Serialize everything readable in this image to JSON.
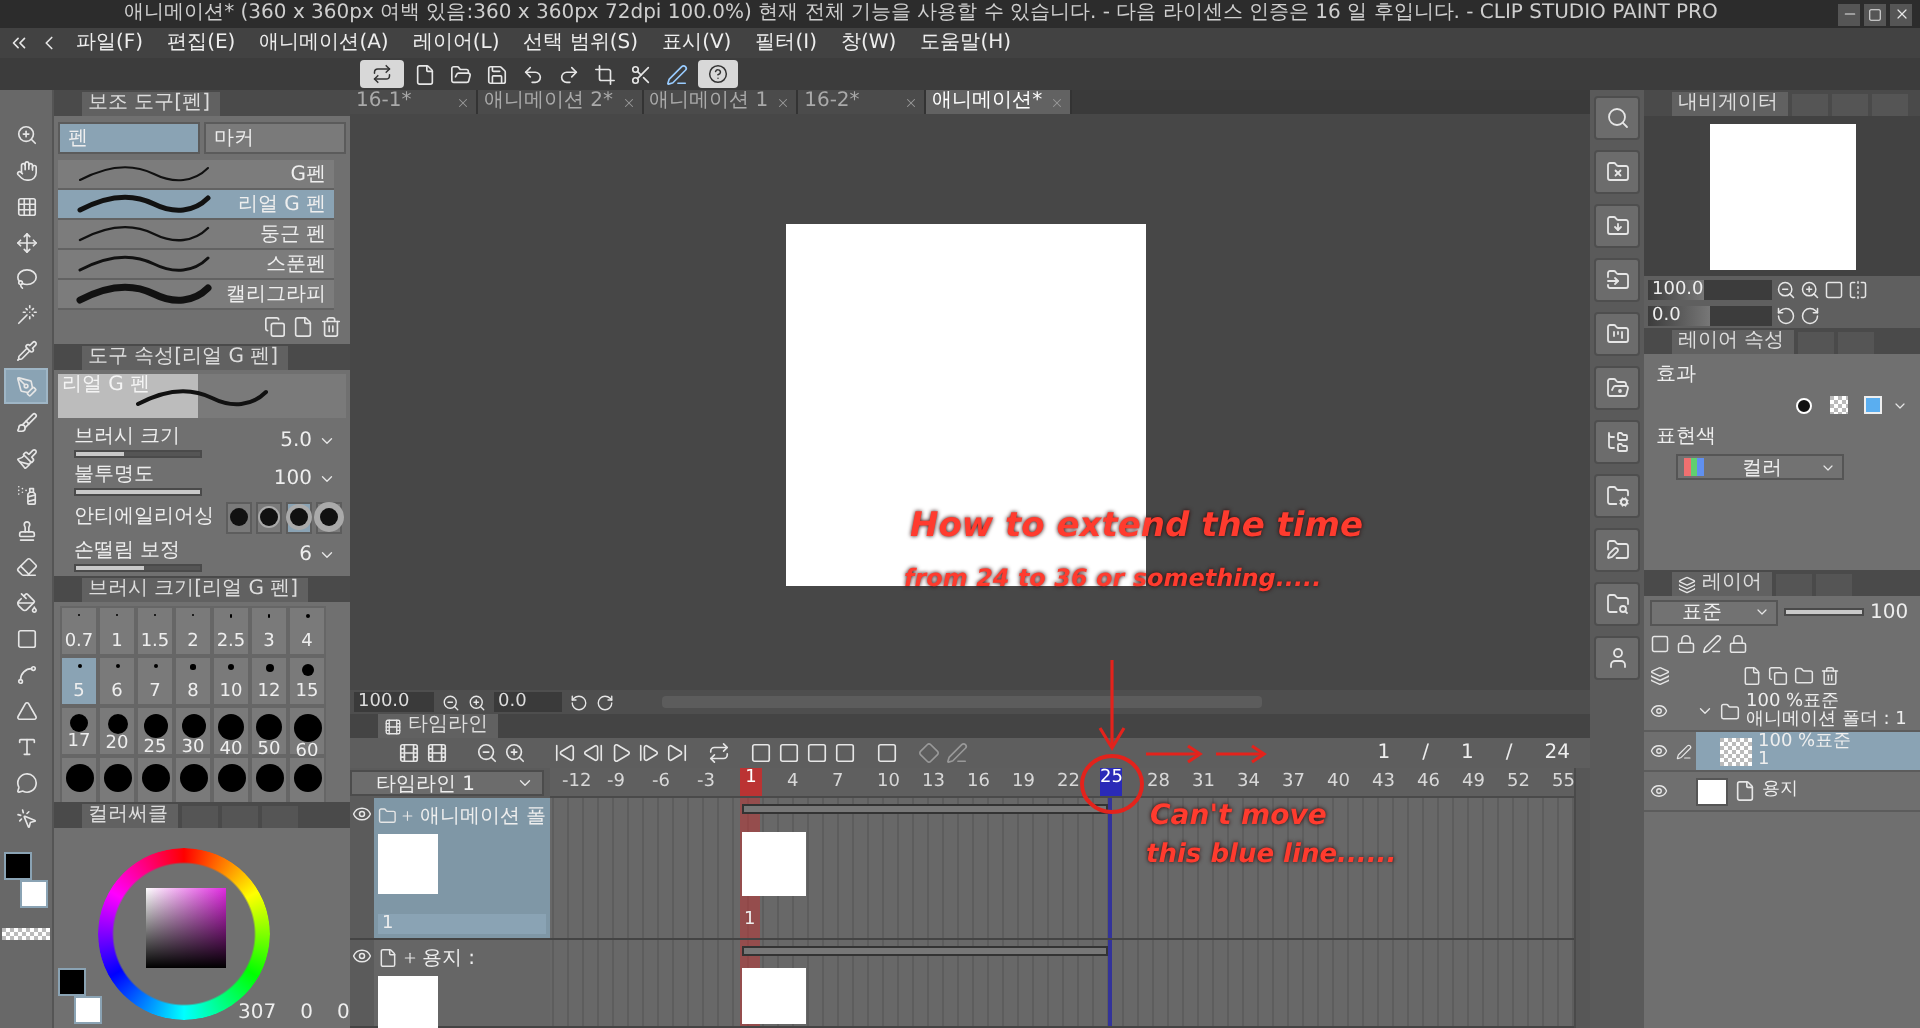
{
  "window": {
    "title": "애니메이션* (360 x 360px 여백 있음:360 x 360px 72dpi 100.0%)  현재 전체 기능을 사용할 수 있습니다. - 다음 라이센스 인증은 16 일 후입니다. - CLIP STUDIO PAINT PRO"
  },
  "menu": [
    "파일(F)",
    "편집(E)",
    "애니메이션(A)",
    "레이어(L)",
    "선택 범위(S)",
    "표시(V)",
    "필터(I)",
    "창(W)",
    "도움말(H)"
  ],
  "tools": [
    {
      "selected": false
    },
    {
      "selected": false
    },
    {
      "selected": false
    },
    {
      "selected": false
    },
    {
      "selected": false
    },
    {
      "selected": false
    },
    {
      "selected": false
    },
    {
      "selected": true
    },
    {
      "selected": false
    },
    {
      "selected": false
    },
    {
      "selected": false
    },
    {
      "selected": false
    },
    {
      "selected": false
    },
    {
      "selected": false
    },
    {
      "selected": false
    },
    {
      "selected": false
    },
    {
      "selected": false
    },
    {
      "selected": false
    },
    {
      "selected": false
    },
    {
      "selected": false
    }
  ],
  "sub_tool": {
    "title": "보조 도구[펜]",
    "groups": [
      {
        "label": "펜",
        "selected": true
      },
      {
        "label": "마커",
        "selected": false
      }
    ],
    "brushes": [
      {
        "name": "G펜",
        "selected": false
      },
      {
        "name": "리얼 G 펜",
        "selected": true
      },
      {
        "name": "둥근 펜",
        "selected": false
      },
      {
        "name": "스푼펜",
        "selected": false
      },
      {
        "name": "캘리그라피",
        "selected": false
      }
    ]
  },
  "tool_property": {
    "title": "도구 속성[리얼 G 펜]",
    "preview_label": "리얼 G 펜",
    "props": [
      {
        "kind": "slider",
        "label": "브러시 크기",
        "value": "5.0",
        "level": 0.38
      },
      {
        "kind": "slider",
        "label": "불투명도",
        "value": "100",
        "level": 1
      },
      {
        "kind": "choice",
        "label": "안티에일리어싱",
        "options": [
          {
            "selected": false
          },
          {
            "selected": false
          },
          {
            "selected": true
          },
          {
            "selected": false
          }
        ]
      },
      {
        "kind": "slider",
        "label": "손떨림 보정",
        "value": "6",
        "level": 0.55
      }
    ]
  },
  "brush_size": {
    "title": "브러시 크기[리얼 G 펜]",
    "sizes": [
      {
        "label": "0.7",
        "selected": false
      },
      {
        "label": "1",
        "selected": false
      },
      {
        "label": "1.5",
        "selected": false
      },
      {
        "label": "2",
        "selected": false
      },
      {
        "label": "2.5",
        "selected": false
      },
      {
        "label": "3",
        "selected": false
      },
      {
        "label": "4",
        "selected": false
      },
      {
        "label": "5",
        "selected": true
      },
      {
        "label": "6",
        "selected": false
      },
      {
        "label": "7",
        "selected": false
      },
      {
        "label": "8",
        "selected": false
      },
      {
        "label": "10",
        "selected": false
      },
      {
        "label": "12",
        "selected": false
      },
      {
        "label": "15",
        "selected": false
      },
      {
        "label": "17",
        "selected": false
      },
      {
        "label": "20",
        "selected": false
      },
      {
        "label": "25",
        "selected": false
      },
      {
        "label": "30",
        "selected": false
      },
      {
        "label": "40",
        "selected": false
      },
      {
        "label": "50",
        "selected": false
      },
      {
        "label": "60",
        "selected": false
      }
    ]
  },
  "color_circle": {
    "title": "컬러써클",
    "readouts": [
      "307",
      "0",
      "0"
    ]
  },
  "doc_tabs": [
    {
      "label": "16-1*",
      "selected": false
    },
    {
      "label": "애니메이션 2*",
      "selected": false
    },
    {
      "label": "애니메이션 1",
      "selected": false
    },
    {
      "label": "16-2*",
      "selected": false
    },
    {
      "label": "애니메이션*",
      "selected": true
    }
  ],
  "canvas_nav": {
    "zoom": "100.0",
    "angle": "0.0"
  },
  "timeline": {
    "title": "타임라인",
    "name": "타임라인 1",
    "counter": [
      "1",
      "/",
      "1",
      "/",
      "24"
    ],
    "ruler": [
      "-12",
      "-9",
      "-6",
      "-3",
      "4",
      "7",
      "10",
      "13",
      "16",
      "19",
      "22",
      "28",
      "31",
      "34",
      "37",
      "40",
      "43",
      "46",
      "49",
      "52",
      "55"
    ],
    "current_frame": "1",
    "end_frame": "25",
    "tracks": [
      {
        "kind": "folder",
        "name": "애니메이션 폴",
        "visible": true,
        "selected": true,
        "layer_label": "1",
        "cel_label": "1"
      },
      {
        "kind": "paper",
        "name": "용지 :",
        "visible": true,
        "selected": false
      }
    ]
  },
  "navigator": {
    "title": "내비게이터",
    "zoom": "100.0",
    "zoom_slider": {
      "level": 0.45
    },
    "angle": "0.0",
    "angle_slider": {
      "level": 0.5
    }
  },
  "layer_property": {
    "title": "레이어 속성",
    "effect_label": "효과",
    "color_label": "표현색",
    "color_value": "컬러"
  },
  "layers": {
    "title": "레이어",
    "blend_mode": "표준",
    "opacity": "100",
    "opacity_slider": {
      "level": 1
    },
    "items": [
      {
        "kind": "folder",
        "visible": true,
        "expanded": true,
        "selected": false,
        "mode": "100 %표준",
        "name": "애니메이션 폴더 : 1",
        "children": [
          {
            "kind": "raster",
            "visible": true,
            "selected": true,
            "mode": "100 %표준",
            "name": "1"
          }
        ]
      },
      {
        "kind": "paper",
        "visible": true,
        "selected": false,
        "name": "용지"
      }
    ]
  },
  "annotations": [
    "How to extend the time",
    "from 24 to 36 or something.....",
    "Can't move",
    "this blue line......"
  ]
}
